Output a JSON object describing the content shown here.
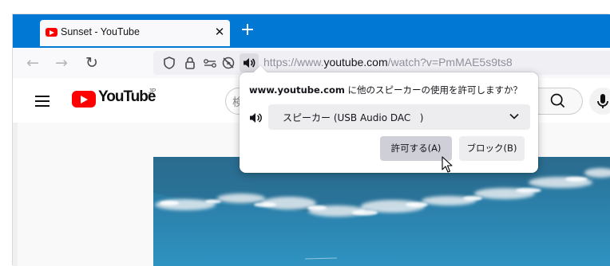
{
  "browser": {
    "tab": {
      "title": "Sunset - YouTube",
      "close_glyph": "✕",
      "favicon": "youtube-favicon"
    },
    "new_tab_glyph": "+",
    "nav": {
      "back_glyph": "←",
      "forward_glyph": "→",
      "reload_glyph": "↻"
    },
    "urlbar": {
      "url_prefix": "https://www.",
      "url_domain": "youtube.com",
      "url_path": "/watch?v=PmMAE5s9ts8",
      "icons": [
        "tracking-shield-icon",
        "lock-icon",
        "permissions-icon",
        "autoplay-blocked-icon",
        "speaker-icon"
      ]
    },
    "accent_color": "#0078d4"
  },
  "youtube": {
    "logo_text": "YouTube",
    "region": "JP",
    "search_placeholder_visible": "検"
  },
  "popup": {
    "message_domain": "www.youtube.com",
    "message_rest": " に他のスピーカーの使用を許可しますか？",
    "device_label": "スピーカー (USB Audio DAC   )",
    "allow_label": "許可する(A)",
    "block_label": "ブロック(B)"
  }
}
